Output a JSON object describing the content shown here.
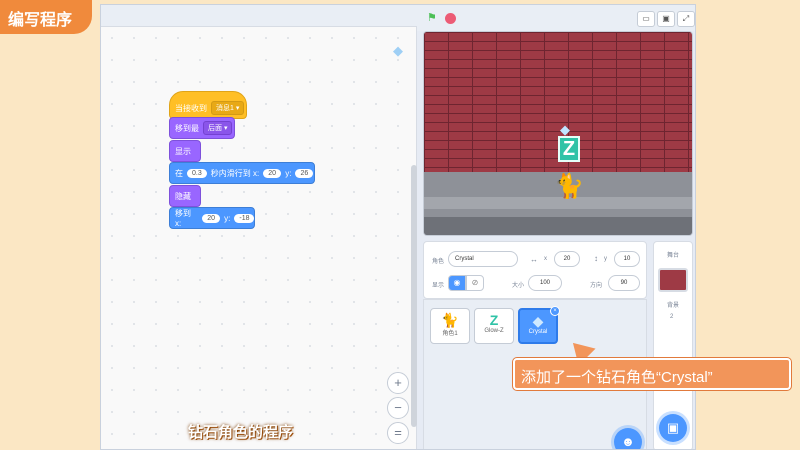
{
  "corner_title": "编写程序",
  "code_blocks": {
    "when_receive": {
      "label": "当接收到",
      "dropdown": "消息1"
    },
    "go_to_layer": {
      "label": "移到最",
      "dropdown": "后面"
    },
    "show": {
      "label": "显示"
    },
    "glide": {
      "prefix": "在",
      "secs": "0.3",
      "mid": "秒内滑行到 x:",
      "x": "20",
      "ylabel": "y:",
      "y": "26"
    },
    "hide": {
      "label": "隐藏"
    },
    "goto_xy": {
      "label": "移到 x:",
      "x": "20",
      "ylabel": "y:",
      "y": "-18"
    }
  },
  "zoom": {
    "in": "+",
    "out": "−",
    "reset": "="
  },
  "stage_controls": {
    "flag": "green-flag-icon",
    "stop": "stop-icon"
  },
  "sprite_info": {
    "sprite_label": "角色",
    "sprite_name": "Crystal",
    "x_label": "x",
    "x_value": "20",
    "y_label": "y",
    "y_value": "10",
    "show_label": "显示",
    "size_label": "大小",
    "size_value": "100",
    "direction_label": "方向",
    "direction_value": "90"
  },
  "sprites": [
    {
      "name": "角色1",
      "icon": "cat-icon"
    },
    {
      "name": "Glow-Z",
      "icon": "z-icon"
    },
    {
      "name": "Crystal",
      "icon": "crystal-icon"
    }
  ],
  "stage_panel": {
    "title": "舞台",
    "backdrop_label": "背景",
    "backdrop_count": "2"
  },
  "callout": "添加了一个钻石角色“Crystal”",
  "subtitle": "钻石角色的程序",
  "colors": {
    "motion": "#4c97ff",
    "looks": "#9966ff",
    "events": "#ffbf26",
    "accent": "#f08a3c"
  }
}
